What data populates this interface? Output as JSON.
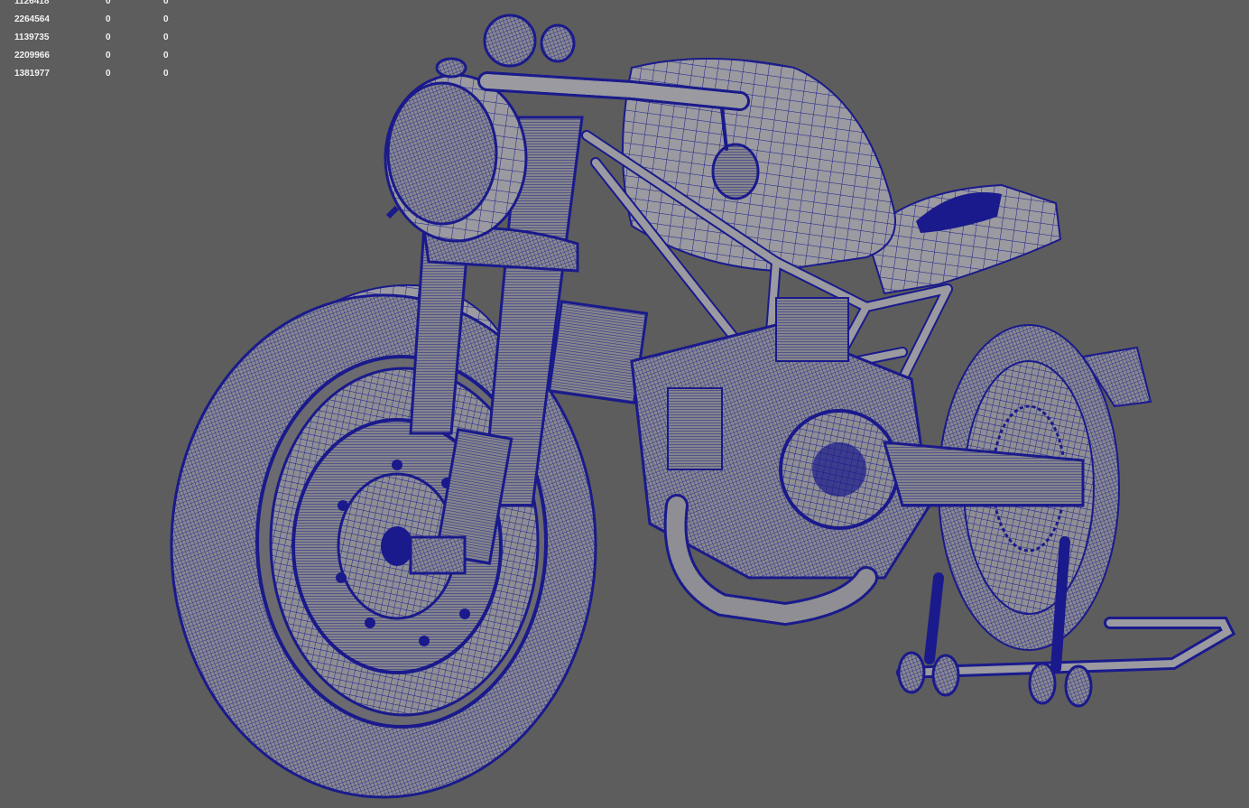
{
  "viewport": {
    "background": "#5d5d5d",
    "wire_color": "#1a1a8c",
    "surface_color": "#8e8e94"
  },
  "hud": {
    "rows": [
      {
        "count": "1126418",
        "a": "0",
        "b": "0"
      },
      {
        "count": "2264564",
        "a": "0",
        "b": "0"
      },
      {
        "count": "1139735",
        "a": "0",
        "b": "0"
      },
      {
        "count": "2209966",
        "a": "0",
        "b": "0"
      },
      {
        "count": "1381977",
        "a": "0",
        "b": "0"
      }
    ]
  },
  "model": {
    "subject": "motorcycle-wireframe",
    "display_mode": "wireframe-on-shaded"
  }
}
